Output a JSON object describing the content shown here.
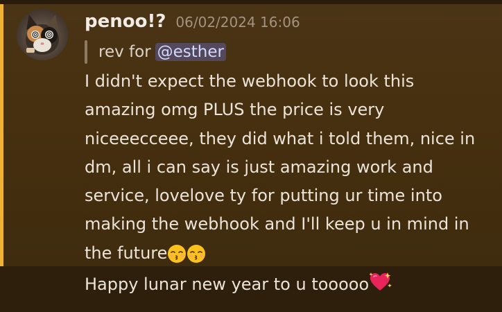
{
  "message": {
    "username": "penoo!?",
    "timestamp": "06/02/2024 16:06",
    "reply": {
      "prefix": "rev for",
      "mention": "@esther"
    },
    "body": "I didn't expect the webhook to look this amazing omg PLUS the price is very niceeecceee, they did what i told them, nice in dm, all i can say is just amazing work and service, lovelove ty for putting ur time into making the webhook and I'll keep u in mind in the future",
    "body_emoji": [
      "kissing-closed-eyes-emoji",
      "kissing-closed-eyes-emoji"
    ]
  },
  "followup": {
    "text": "Happy lunar new year to u tooooo",
    "emoji": "sparkling-heart-emoji"
  },
  "colors": {
    "mention_bar": "#f0b232",
    "mention_text": "#d3d8ff",
    "username": "#f2ece4",
    "timestamp": "#a39380"
  }
}
